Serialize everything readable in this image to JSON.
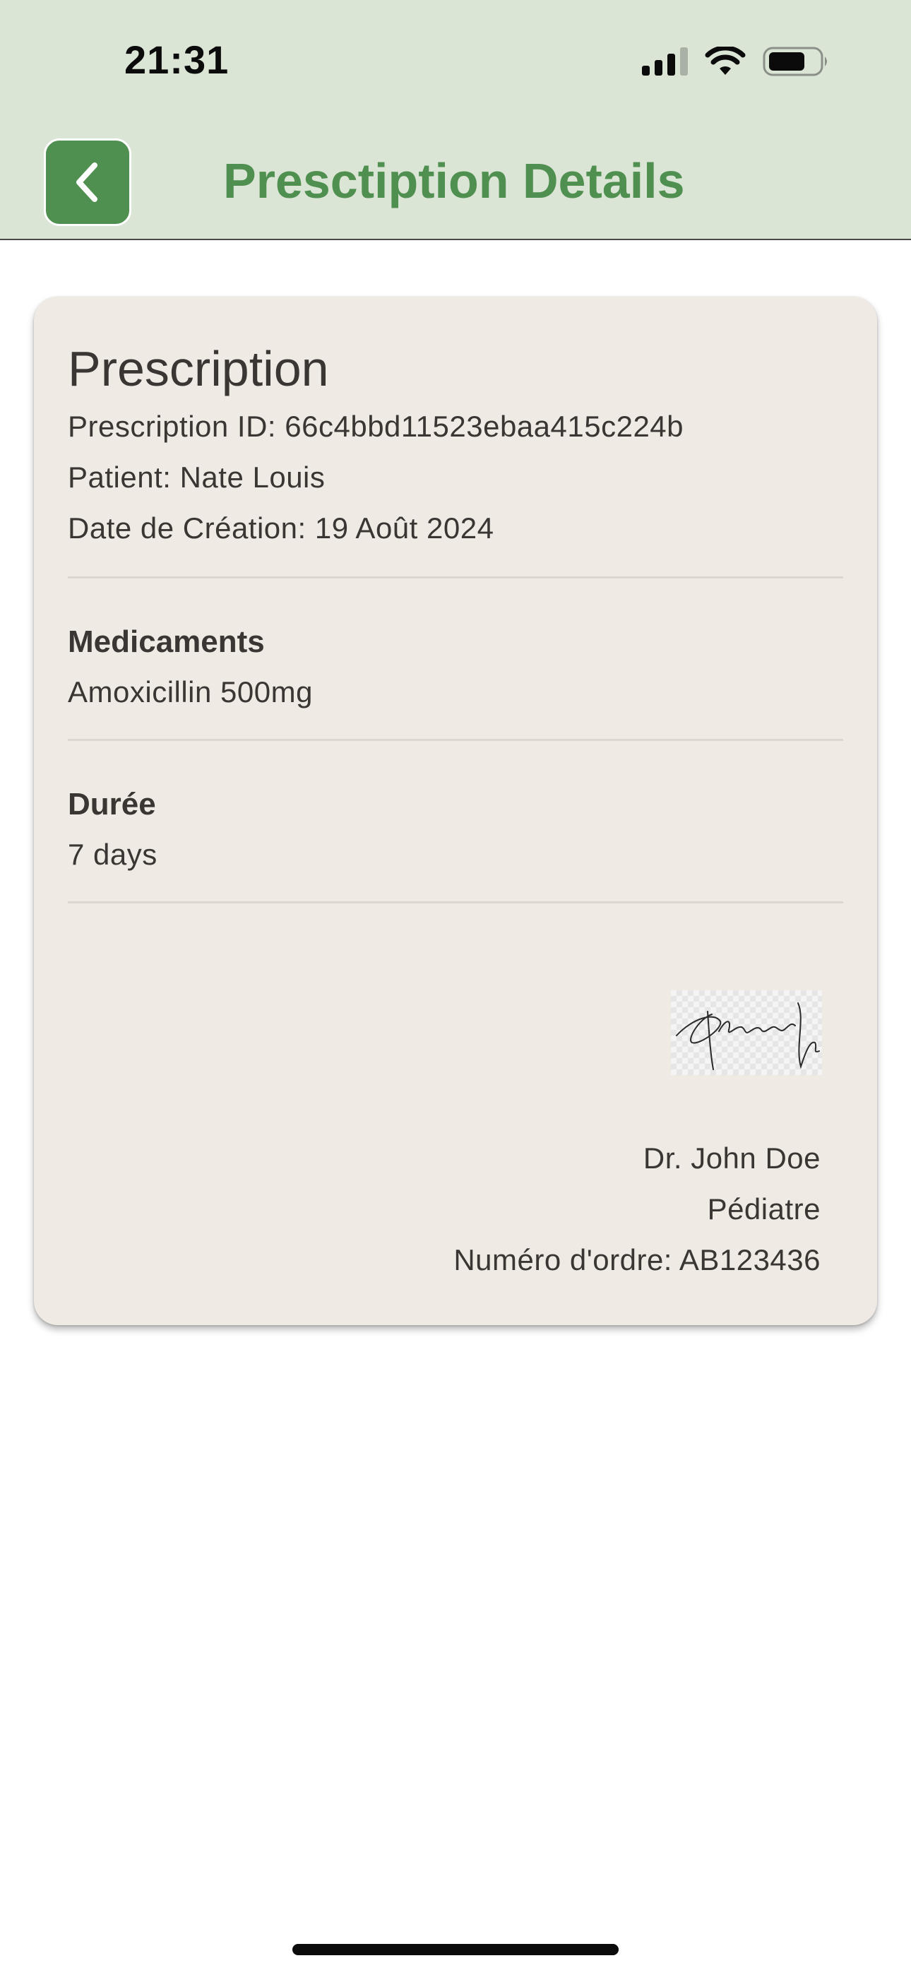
{
  "status_bar": {
    "time": "21:31",
    "icons": [
      "cellular-signal-icon",
      "wifi-icon",
      "battery-icon"
    ]
  },
  "header": {
    "back_icon": "chevron-left-icon",
    "title": "Presctiption Details"
  },
  "prescription": {
    "title": "Prescription",
    "id_line": "Prescription ID: 66c4bbd11523ebaa415c224b",
    "patient_line": "Patient: Nate Louis",
    "date_line": "Date de Création: 19 Août 2024",
    "medications": {
      "heading": "Medicaments",
      "value": "Amoxicillin 500mg"
    },
    "duration": {
      "heading": "Durée",
      "value": "7 days"
    }
  },
  "doctor": {
    "name": "Dr. John Doe",
    "specialty": "Pédiatre",
    "order_number": "Numéro d'ordre: AB123436"
  },
  "colors": {
    "header_bg": "#dbe5d6",
    "accent_green": "#4f8f4f",
    "card_bg": "#efebe4",
    "text": "#3a3634"
  }
}
